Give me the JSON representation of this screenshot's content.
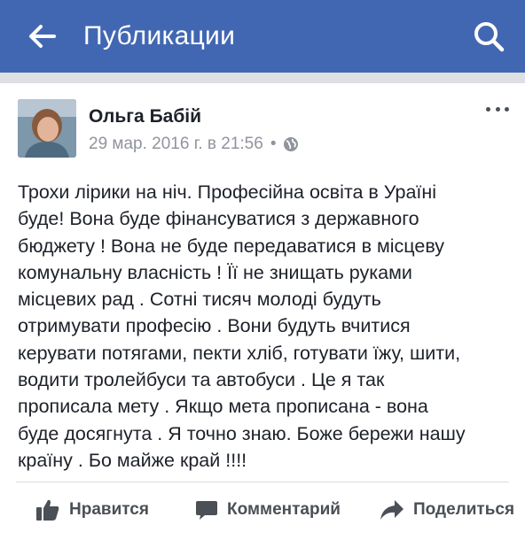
{
  "header": {
    "back_icon": "arrow-left-icon",
    "title": "Публикации",
    "search_icon": "search-icon",
    "background_color": "#4267b2"
  },
  "post": {
    "author": "Ольга Бабій",
    "timestamp": "29 мар. 2016 г. в 21:56",
    "separator": "•",
    "privacy_icon": "globe-icon",
    "menu_icon": "more-dots-icon",
    "text": "Трохи лірики на ніч. Професійна освіта в Ураїні\nбуде! Вона буде фінансуватися з державного\nбюджету ! Вона не буде передаватися в місцеву\nкомунальну власність ! Її не знищать руками\nмісцевих рад . Сотні тисяч молоді будуть\nотримувати професію . Вони будуть вчитися\nкерувати потягами, пекти хліб, готувати їжу, шити,\nводити тролейбуси та автобуси . Це я так\nпрописала мету . Якщо мета прописана - вона\nбуде досягнута . Я точно знаю. Боже бережи нашу\nкраїну . Бо майже край !!!!"
  },
  "actions": {
    "like_label": "Нравится",
    "comment_label": "Комментарий",
    "share_label": "Поделиться",
    "like_icon": "thumbs-up-icon",
    "comment_icon": "speech-bubble-icon",
    "share_icon": "share-arrow-icon"
  }
}
